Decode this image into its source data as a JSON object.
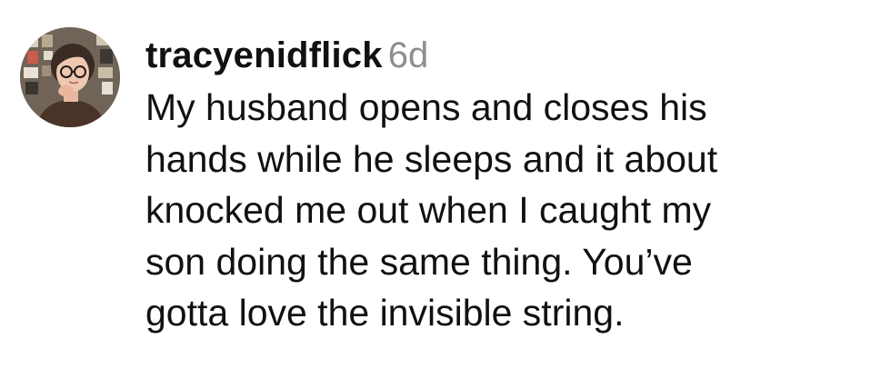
{
  "comment": {
    "username": "tracyenidflick",
    "timestamp": "6d",
    "avatar_icon": "user-avatar-photo",
    "lines": [
      "My husband opens and closes his",
      "hands while he sleeps and it about",
      "knocked me out when I caught my",
      "son doing the same thing. You’ve",
      "gotta love the invisible string."
    ]
  },
  "colors": {
    "text": "#111111",
    "timestamp": "#8e8e8e",
    "background": "#ffffff"
  }
}
